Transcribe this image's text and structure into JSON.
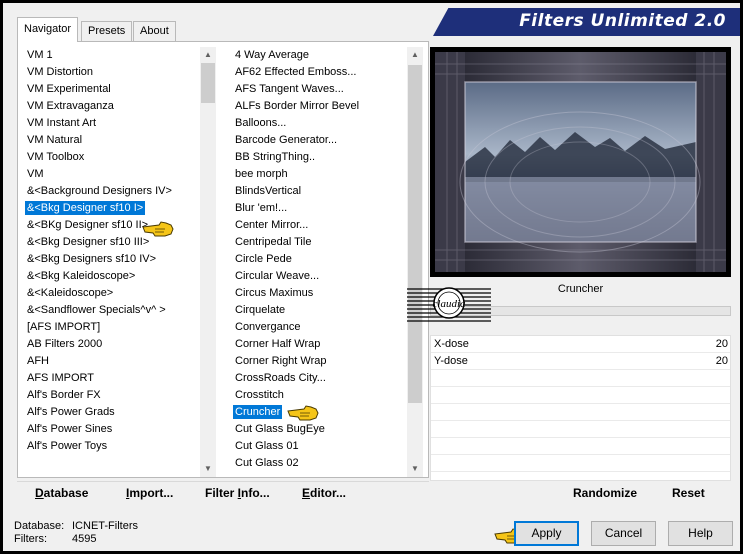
{
  "window": {
    "title": "Filters Unlimited 2.0"
  },
  "tabs": [
    {
      "label": "Navigator",
      "active": true
    },
    {
      "label": "Presets",
      "active": false
    },
    {
      "label": "About",
      "active": false
    }
  ],
  "categories": {
    "items": [
      "VM 1",
      "VM Distortion",
      "VM Experimental",
      "VM Extravaganza",
      "VM Instant Art",
      "VM Natural",
      "VM Toolbox",
      "VM",
      "&<Background Designers IV>",
      "&<Bkg Designer sf10 I>",
      "&<BKg Designer sf10 II>",
      "&<Bkg Designer sf10 III>",
      "&<Bkg Designers sf10 IV>",
      "&<Bkg Kaleidoscope>",
      "&<Kaleidoscope>",
      "&<Sandflower Specials^v^ >",
      "[AFS IMPORT]",
      "AB Filters 2000",
      "AFH",
      "AFS IMPORT",
      "Alf's Border FX",
      "Alf's Power Grads",
      "Alf's Power Sines",
      "Alf's Power Toys"
    ],
    "selected": "&<Bkg Designer sf10 I>"
  },
  "filters": {
    "items": [
      "4 Way Average",
      "AF62 Effected Emboss...",
      "AFS Tangent Waves...",
      "ALFs Border Mirror Bevel",
      "Balloons...",
      "Barcode Generator...",
      "BB StringThing..",
      "bee morph",
      "BlindsVertical",
      "Blur 'em!...",
      "Center Mirror...",
      "Centripedal Tile",
      "Circle Pede",
      "Circular Weave...",
      "Circus Maximus",
      "Cirquelate",
      "Convergance",
      "Corner Half Wrap",
      "Corner Right Wrap",
      "CrossRoads City...",
      "Crosstitch",
      "Cruncher",
      "Cut Glass  BugEye",
      "Cut Glass 01",
      "Cut Glass 02"
    ],
    "selected": "Cruncher"
  },
  "toolbar": {
    "database": {
      "underlined": "D",
      "rest": "atabase"
    },
    "import": {
      "underlined": "I",
      "rest": "mport..."
    },
    "filter_info": {
      "prefix": "Filter ",
      "underlined": "I",
      "rest": "nfo..."
    },
    "editor": {
      "underlined": "E",
      "rest": "ditor..."
    }
  },
  "preview": {
    "filter_name": "Cruncher",
    "progress": 0
  },
  "logo": {
    "text": "claudia"
  },
  "params": [
    {
      "label": "X-dose",
      "value": "20"
    },
    {
      "label": "Y-dose",
      "value": "20"
    }
  ],
  "actions": {
    "randomize": "Randomize",
    "reset": "Reset"
  },
  "status": {
    "database_label": "Database:",
    "database_value": "ICNET-Filters",
    "filters_label": "Filters:",
    "filters_value": "4595"
  },
  "buttons": {
    "apply": "Apply",
    "cancel": "Cancel",
    "help": "Help"
  },
  "colors": {
    "banner": "#1e2f7a",
    "selection": "#0078d7",
    "pointer": "#f5c518"
  }
}
